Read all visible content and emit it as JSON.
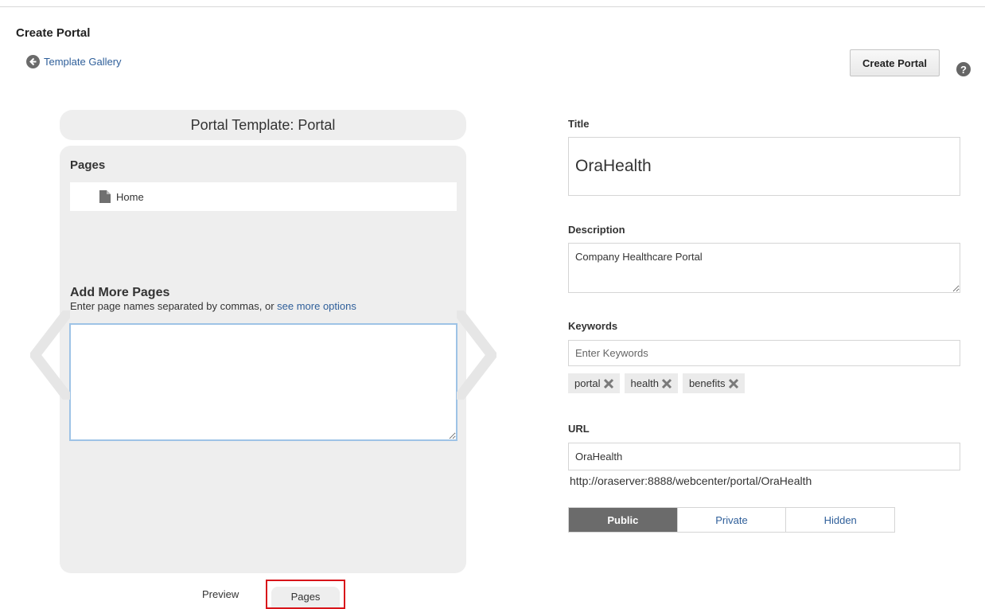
{
  "header": {
    "page_title": "Create Portal",
    "back_link": "Template Gallery",
    "create_button": "Create Portal",
    "help_symbol": "?"
  },
  "template_pane": {
    "title": "Portal Template: Portal",
    "pages_heading": "Pages",
    "pages": [
      {
        "label": "Home",
        "icon": "page-icon"
      }
    ],
    "add_heading": "Add More Pages",
    "add_help": "Enter page names separated by commas, or ",
    "add_help_link": "see more options",
    "textarea_value": ""
  },
  "view_tabs": [
    {
      "label": "Preview",
      "selected": false
    },
    {
      "label": "Pages",
      "selected": true
    }
  ],
  "form": {
    "title_label": "Title",
    "title_value": "OraHealth",
    "description_label": "Description",
    "description_value": "Company Healthcare Portal",
    "keywords_label": "Keywords",
    "keywords_placeholder": "Enter Keywords",
    "keywords": [
      "portal",
      "health",
      "benefits"
    ],
    "url_label": "URL",
    "url_value": "OraHealth",
    "url_preview": "http://oraserver:8888/webcenter/portal/OraHealth",
    "visibility_options": [
      "Public",
      "Private",
      "Hidden"
    ],
    "visibility_selected": "Public"
  },
  "colors": {
    "link": "#2f5f9a",
    "selected_segment": "#6b6b6b",
    "highlight_border": "#d8141a",
    "textarea_focus": "#9ec3e6"
  }
}
